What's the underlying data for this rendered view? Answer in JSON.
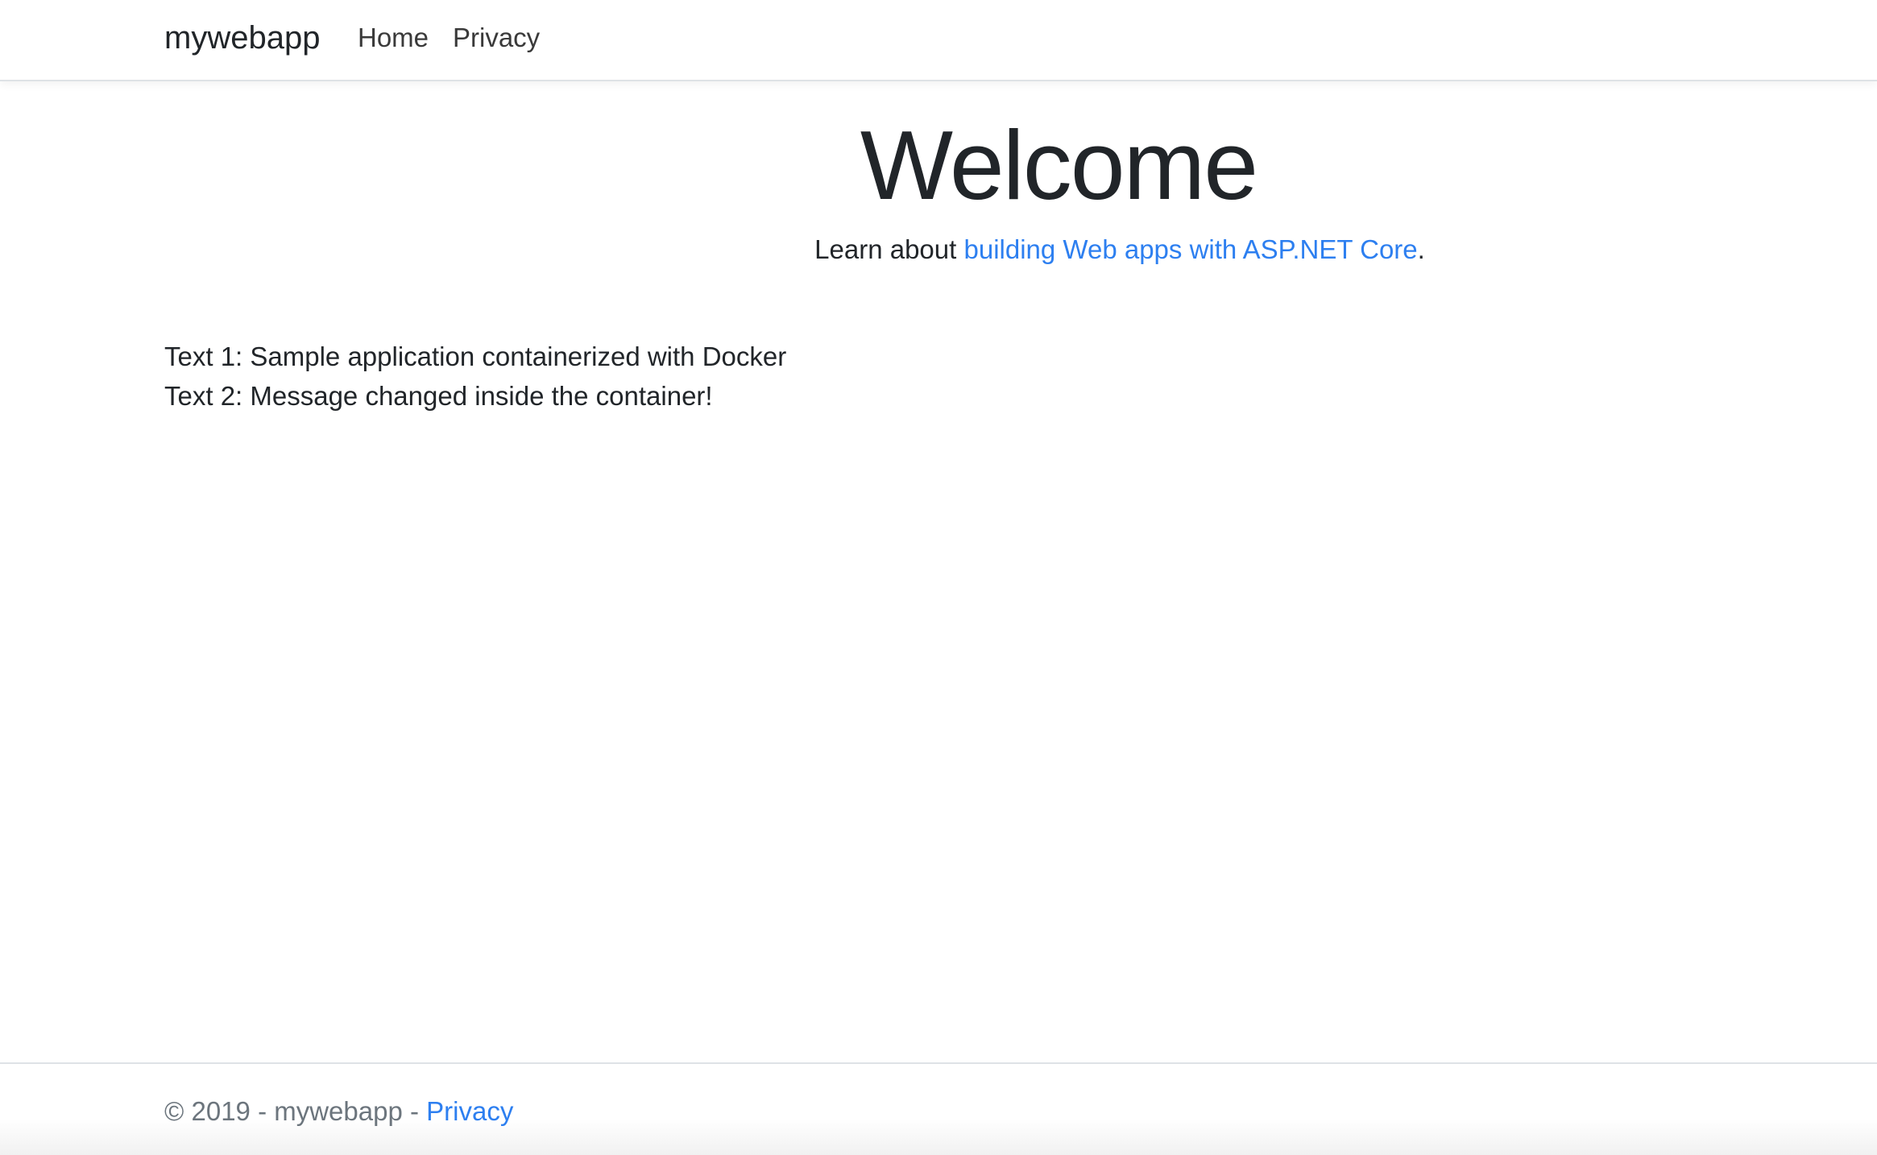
{
  "navbar": {
    "brand": "mywebapp",
    "links": [
      {
        "label": "Home"
      },
      {
        "label": "Privacy"
      }
    ]
  },
  "main": {
    "title": "Welcome",
    "learn_prefix": "Learn about ",
    "learn_link": "building Web apps with ASP.NET Core",
    "learn_suffix": ".",
    "text_lines": [
      "Text 1: Sample application containerized with Docker",
      "Text 2: Message changed inside the container!"
    ]
  },
  "footer": {
    "copyright": "© 2019 - mywebapp - ",
    "privacy_link": "Privacy"
  },
  "colors": {
    "link": "#2d7ff0",
    "text": "#212529",
    "muted": "#6c757d"
  }
}
